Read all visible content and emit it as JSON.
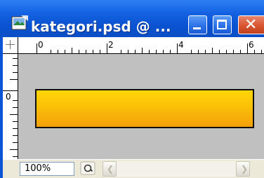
{
  "window": {
    "title": "kategori.psd @ ...",
    "title_color": "#ffffff",
    "titlebar_color": "#0a54d6"
  },
  "title_buttons": {
    "minimize_icon": "minimize-icon",
    "maximize_icon": "maximize-icon",
    "close_icon": "close-icon",
    "close_glyph": "✕"
  },
  "rulers": {
    "top_labels": [
      "0",
      "2",
      "4",
      "6"
    ],
    "left_labels": [
      "0"
    ]
  },
  "canvas": {
    "bar_color_top": "#ffd60a",
    "bar_color_bottom": "#f3a10a",
    "background": "#c0c0c0"
  },
  "status": {
    "zoom": "100%",
    "status_icon": "navigator-icon"
  }
}
